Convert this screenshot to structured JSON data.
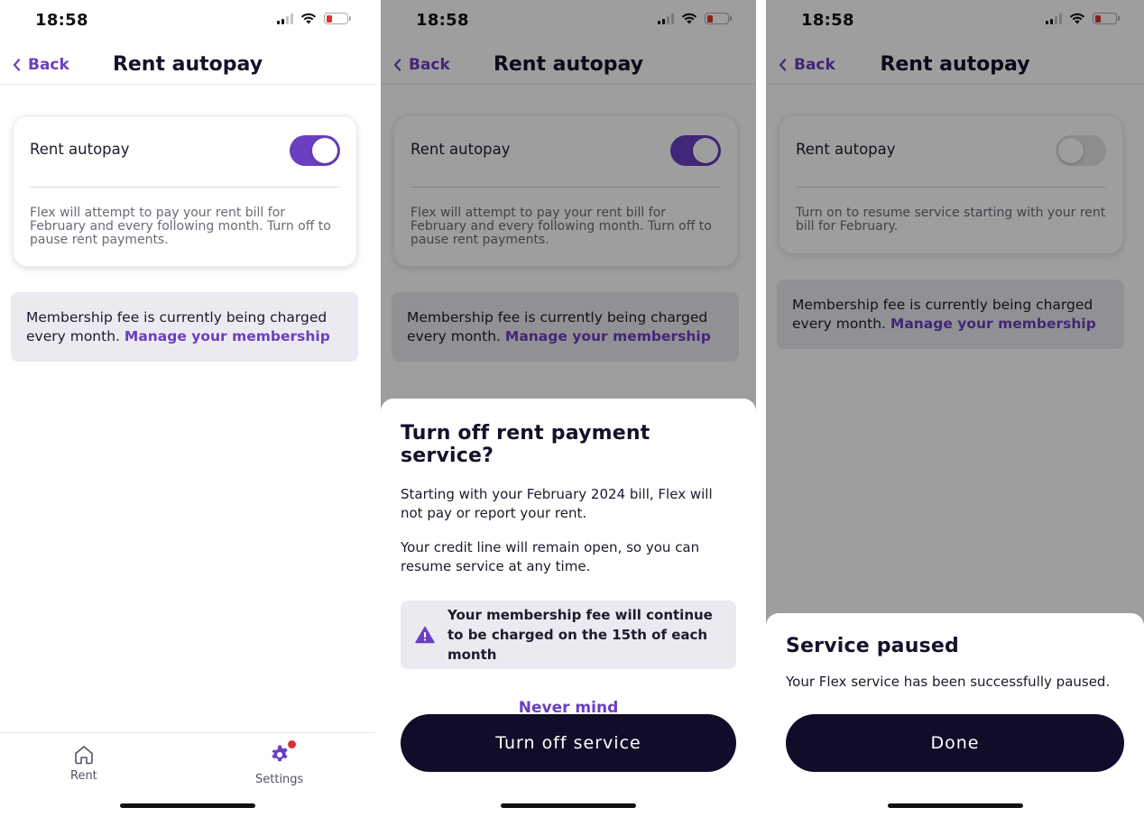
{
  "status_bar": {
    "time": "18:58"
  },
  "nav": {
    "back_label": "Back",
    "title": "Rent autopay"
  },
  "card": {
    "label": "Rent autopay",
    "desc_on": "Flex will attempt to pay your rent bill for February and every following month. Turn off to pause rent payments.",
    "desc_off": "Turn on to resume service starting with your rent bill for February."
  },
  "membership": {
    "text": "Membership fee is currently being charged every month.",
    "link": "Manage your membership"
  },
  "tabs": {
    "rent": "Rent",
    "settings": "Settings"
  },
  "dialog": {
    "title": "Turn off rent payment service?",
    "body1": "Starting with your February 2024 bill, Flex will not pay or report your rent.",
    "body2": "Your credit line will remain open, so you can resume service at any time.",
    "warning": "Your membership fee will continue to be charged on the 15th of each month",
    "never_mind": "Never mind",
    "confirm": "Turn off service"
  },
  "paused": {
    "title": "Service paused",
    "body": "Your Flex service has been successfully paused.",
    "done": "Done"
  },
  "colors": {
    "accent": "#6a3fc1",
    "primary_button": "#120c2a",
    "badge": "#d63332"
  }
}
